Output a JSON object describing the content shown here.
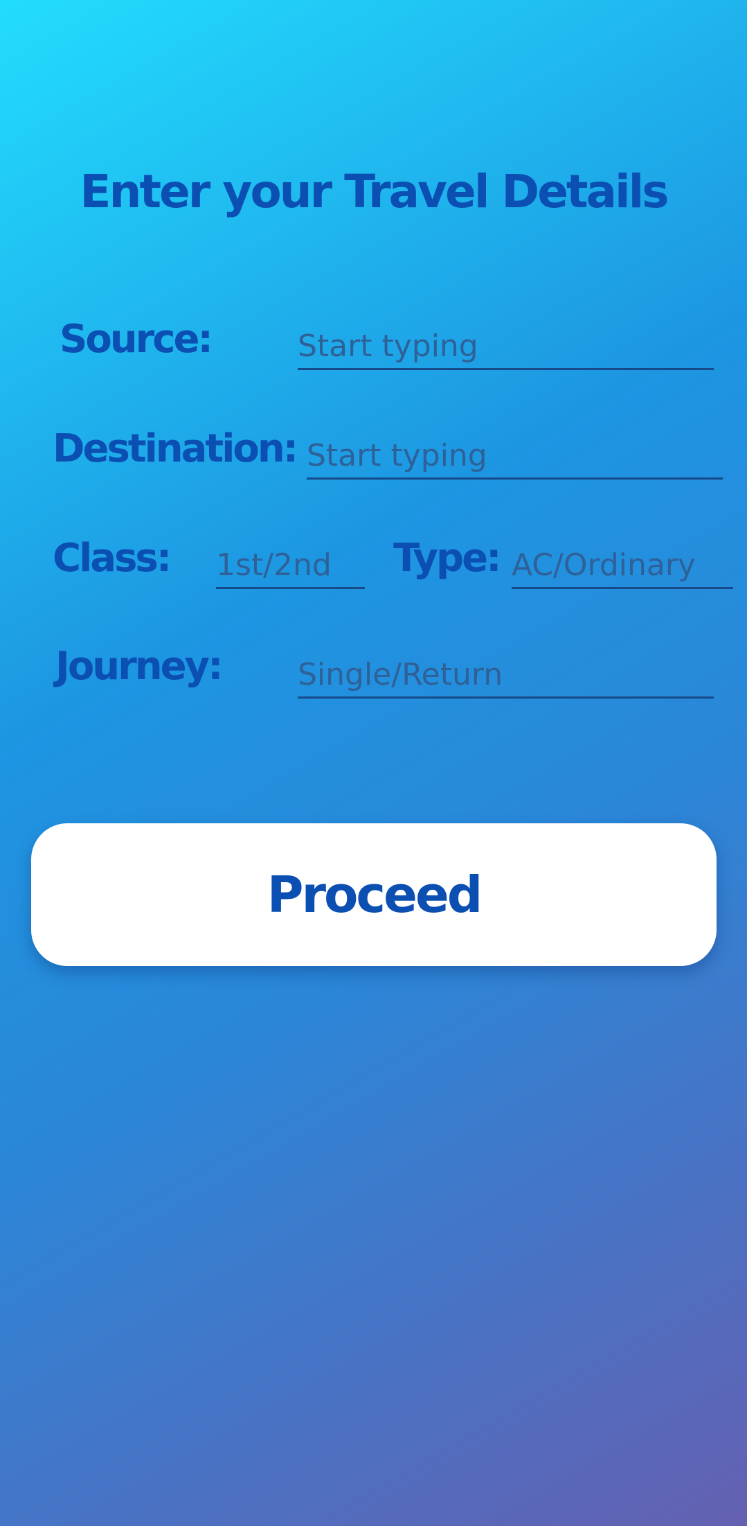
{
  "header": {
    "title": "Enter your Travel Details"
  },
  "form": {
    "source": {
      "label": "Source:",
      "placeholder": "Start typing"
    },
    "destination": {
      "label": "Destination:",
      "placeholder": "Start typing"
    },
    "class": {
      "label": "Class:",
      "placeholder": "1st/2nd"
    },
    "type": {
      "label": "Type:",
      "placeholder": "AC/Ordinary"
    },
    "journey": {
      "label": "Journey:",
      "placeholder": "Single/Return"
    }
  },
  "actions": {
    "proceed_label": "Proceed"
  },
  "colors": {
    "accent": "#0b4fb2",
    "field_underline": "#164a88",
    "button_bg": "#ffffff",
    "gradient_start": "#22ddfd",
    "gradient_end": "#6560b1"
  }
}
